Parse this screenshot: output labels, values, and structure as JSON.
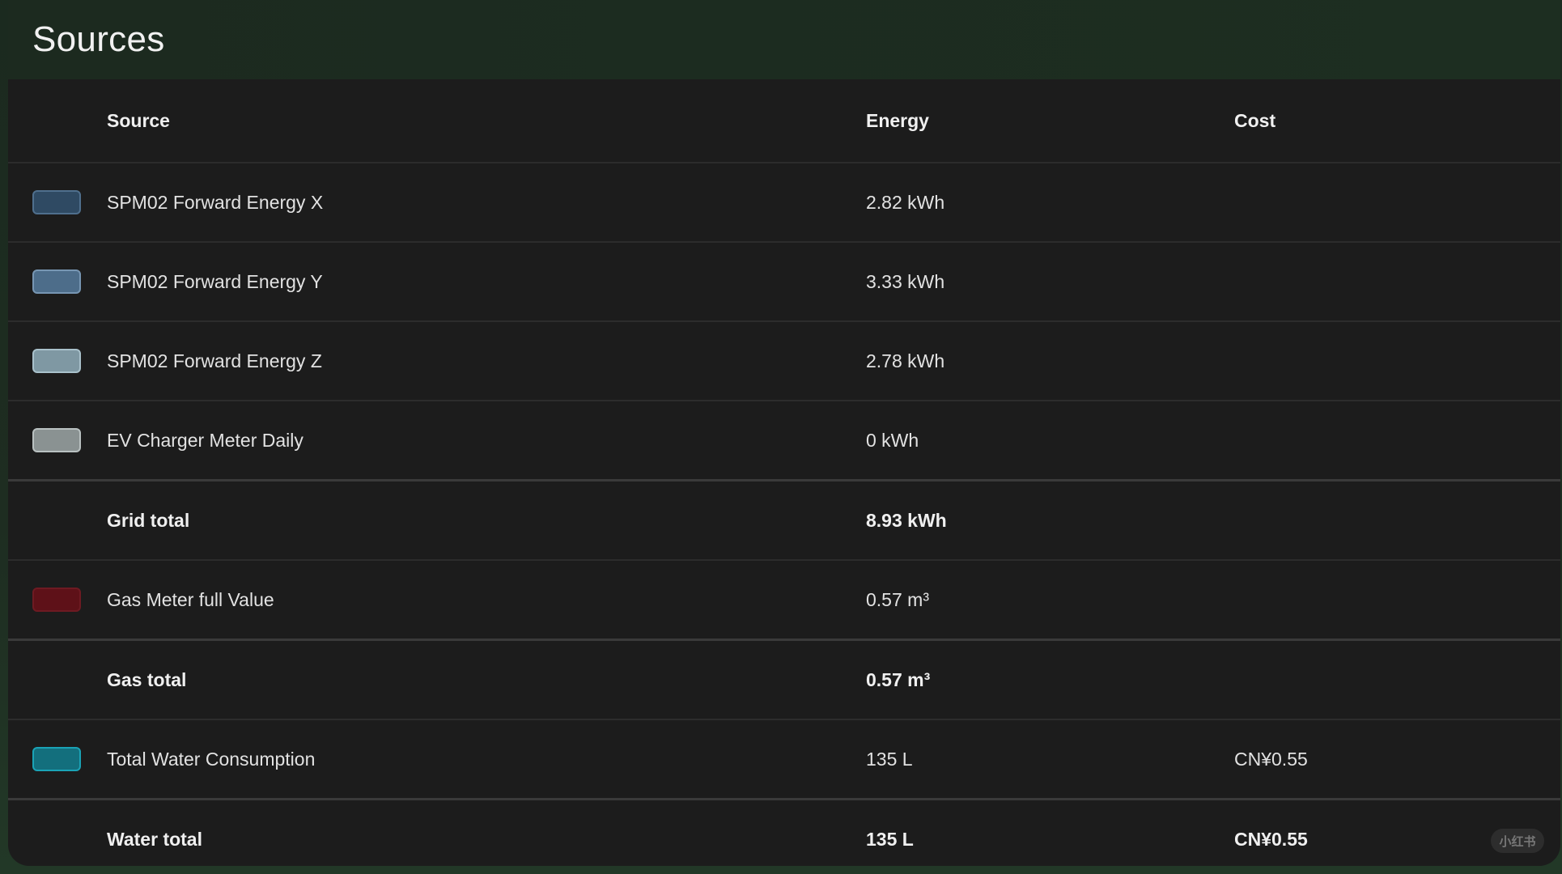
{
  "card": {
    "title": "Sources"
  },
  "columns": {
    "source": "Source",
    "energy": "Energy",
    "cost": "Cost"
  },
  "rows": [
    {
      "type": "source",
      "label": "SPM02 Forward Energy X",
      "energy": "2.82 kWh",
      "cost": "",
      "color": "#2f4a63",
      "border": "#4f6f8d"
    },
    {
      "type": "source",
      "label": "SPM02 Forward Energy Y",
      "energy": "3.33 kWh",
      "cost": "",
      "color": "#4d6d8a",
      "border": "#7796b3"
    },
    {
      "type": "source",
      "label": "SPM02 Forward Energy Z",
      "energy": "2.78 kWh",
      "cost": "",
      "color": "#7f98a3",
      "border": "#a9c1cb"
    },
    {
      "type": "source",
      "label": "EV Charger Meter Daily",
      "energy": "0 kWh",
      "cost": "",
      "color": "#8a9292",
      "border": "#b9c1c1"
    },
    {
      "type": "total",
      "label": "Grid total",
      "energy": "8.93 kWh",
      "cost": ""
    },
    {
      "type": "source",
      "label": "Gas Meter full Value",
      "energy": "0.57 m³",
      "cost": "",
      "color": "#5e1118",
      "border": "#6e1a22"
    },
    {
      "type": "total",
      "label": "Gas total",
      "energy": "0.57 m³",
      "cost": ""
    },
    {
      "type": "source",
      "label": "Total Water Consumption",
      "energy": "135 L",
      "cost": "CN¥0.55",
      "color": "#136f7d",
      "border": "#1aa3b6"
    },
    {
      "type": "total",
      "label": "Water total",
      "energy": "135 L",
      "cost": "CN¥0.55"
    }
  ],
  "watermark": "小红书"
}
